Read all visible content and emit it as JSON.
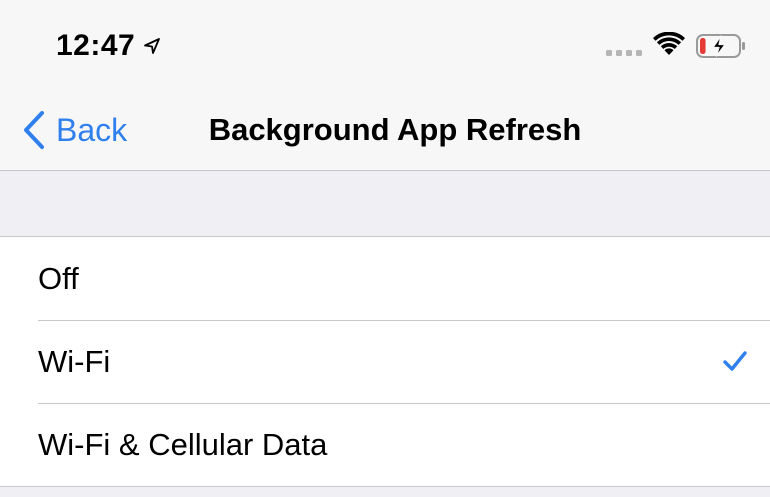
{
  "status_bar": {
    "time": "12:47",
    "location_icon": "location-arrow-icon",
    "signal_icon": "cellular-signal-icon",
    "wifi_icon": "wifi-icon",
    "battery_icon": "battery-charging-icon",
    "battery_level_fraction": 0.15,
    "battery_low_color": "#e53935"
  },
  "nav": {
    "back_label": "Back",
    "title": "Background App Refresh",
    "accent_color": "#2f80ed"
  },
  "options": [
    {
      "label": "Off",
      "selected": false
    },
    {
      "label": "Wi-Fi",
      "selected": true
    },
    {
      "label": "Wi-Fi & Cellular Data",
      "selected": false
    }
  ],
  "checkmark_icon": "checkmark-icon"
}
